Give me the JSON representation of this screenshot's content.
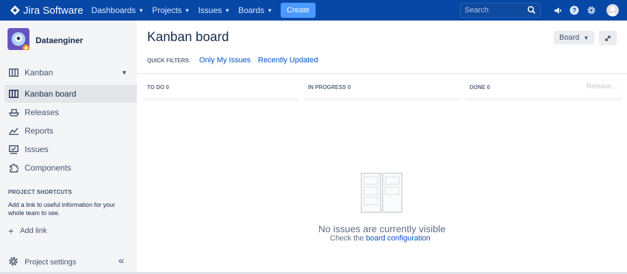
{
  "topbar": {
    "brand": "Jira Software",
    "nav": [
      "Dashboards",
      "Projects",
      "Issues",
      "Boards"
    ],
    "create_label": "Create",
    "search_placeholder": "Search"
  },
  "sidebar": {
    "project_name": "Dataenginer",
    "board_selector": "Kanban",
    "items": [
      {
        "label": "Kanban board",
        "icon": "board-icon",
        "active": true
      },
      {
        "label": "Releases",
        "icon": "ship-icon"
      },
      {
        "label": "Reports",
        "icon": "chart-icon"
      },
      {
        "label": "Issues",
        "icon": "issues-icon"
      },
      {
        "label": "Components",
        "icon": "puzzle-icon"
      }
    ],
    "shortcuts_heading": "PROJECT SHORTCUTS",
    "shortcuts_desc": "Add a link to useful information for your whole team to see.",
    "add_link": "Add link",
    "project_settings": "Project settings"
  },
  "main": {
    "title": "Kanban board",
    "board_button": "Board",
    "quick_filters_label": "QUICK FILTERS:",
    "quick_filters": [
      "Only My Issues",
      "Recently Updated"
    ],
    "columns": [
      {
        "name": "TO DO",
        "count": "0"
      },
      {
        "name": "IN PROGRESS",
        "count": "0"
      },
      {
        "name": "DONE",
        "count": "0"
      }
    ],
    "release_label": "Release...",
    "empty_title": "No issues are currently visible",
    "empty_prefix": "Check the",
    "empty_link": "board configuration"
  },
  "colors": {
    "topbar": "#0747a6",
    "link": "#0052cc",
    "create": "#4c9aff",
    "sidebar": "#f4f5f7"
  }
}
